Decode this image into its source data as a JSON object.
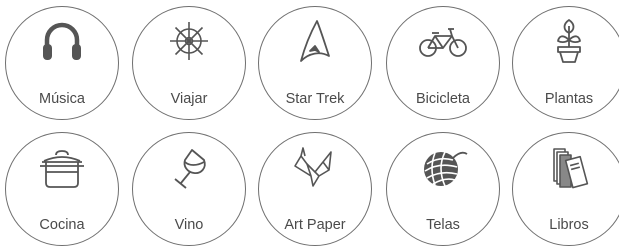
{
  "colors": {
    "stroke": "#6f6f6f",
    "icon": "#555555",
    "text": "#4a4a4a",
    "background": "#ffffff"
  },
  "interests": [
    {
      "label": "Música",
      "icon": "headphones-icon"
    },
    {
      "label": "Viajar",
      "icon": "ship-wheel-icon"
    },
    {
      "label": "Star Trek",
      "icon": "starfleet-insignia-icon"
    },
    {
      "label": "Bicicleta",
      "icon": "bicycle-icon"
    },
    {
      "label": "Plantas",
      "icon": "potted-plant-icon"
    },
    {
      "label": "Cocina",
      "icon": "cooking-pot-icon"
    },
    {
      "label": "Vino",
      "icon": "wine-glass-icon"
    },
    {
      "label": "Art Paper",
      "icon": "origami-bird-icon"
    },
    {
      "label": "Telas",
      "icon": "yarn-ball-icon"
    },
    {
      "label": "Libros",
      "icon": "books-icon"
    }
  ]
}
